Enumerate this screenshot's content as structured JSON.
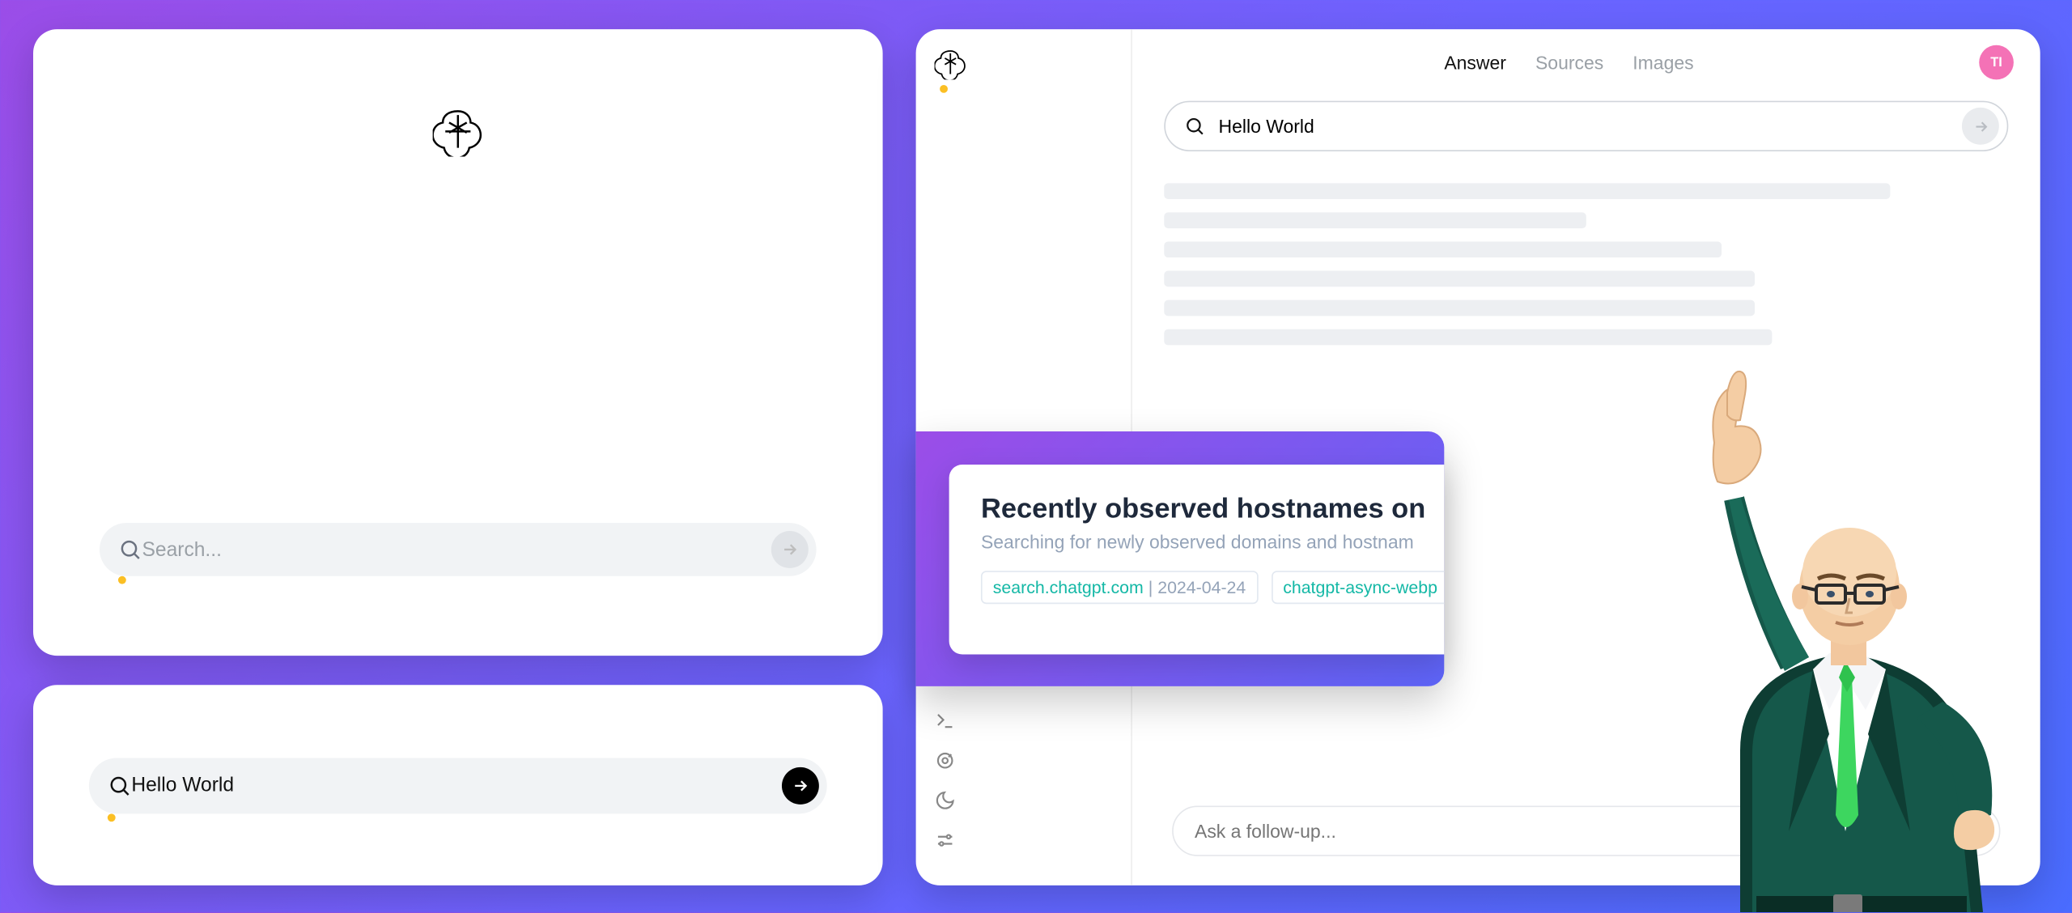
{
  "panel1": {
    "search_placeholder": "Search...",
    "search_value": ""
  },
  "panel2": {
    "search_value": "Hello World"
  },
  "panel3": {
    "tabs": {
      "answer": "Answer",
      "sources": "Sources",
      "images": "Images"
    },
    "avatar_initials": "TI",
    "search_value": "Hello World",
    "followup_placeholder": "Ask a follow-up..."
  },
  "hostcard": {
    "title": "Recently observed hostnames on",
    "subtitle": "Searching for newly observed domains and hostnam",
    "chip1_host": "search.chatgpt.com",
    "chip1_date": "2024-04-24",
    "chip2_host": "chatgpt-async-webp"
  }
}
